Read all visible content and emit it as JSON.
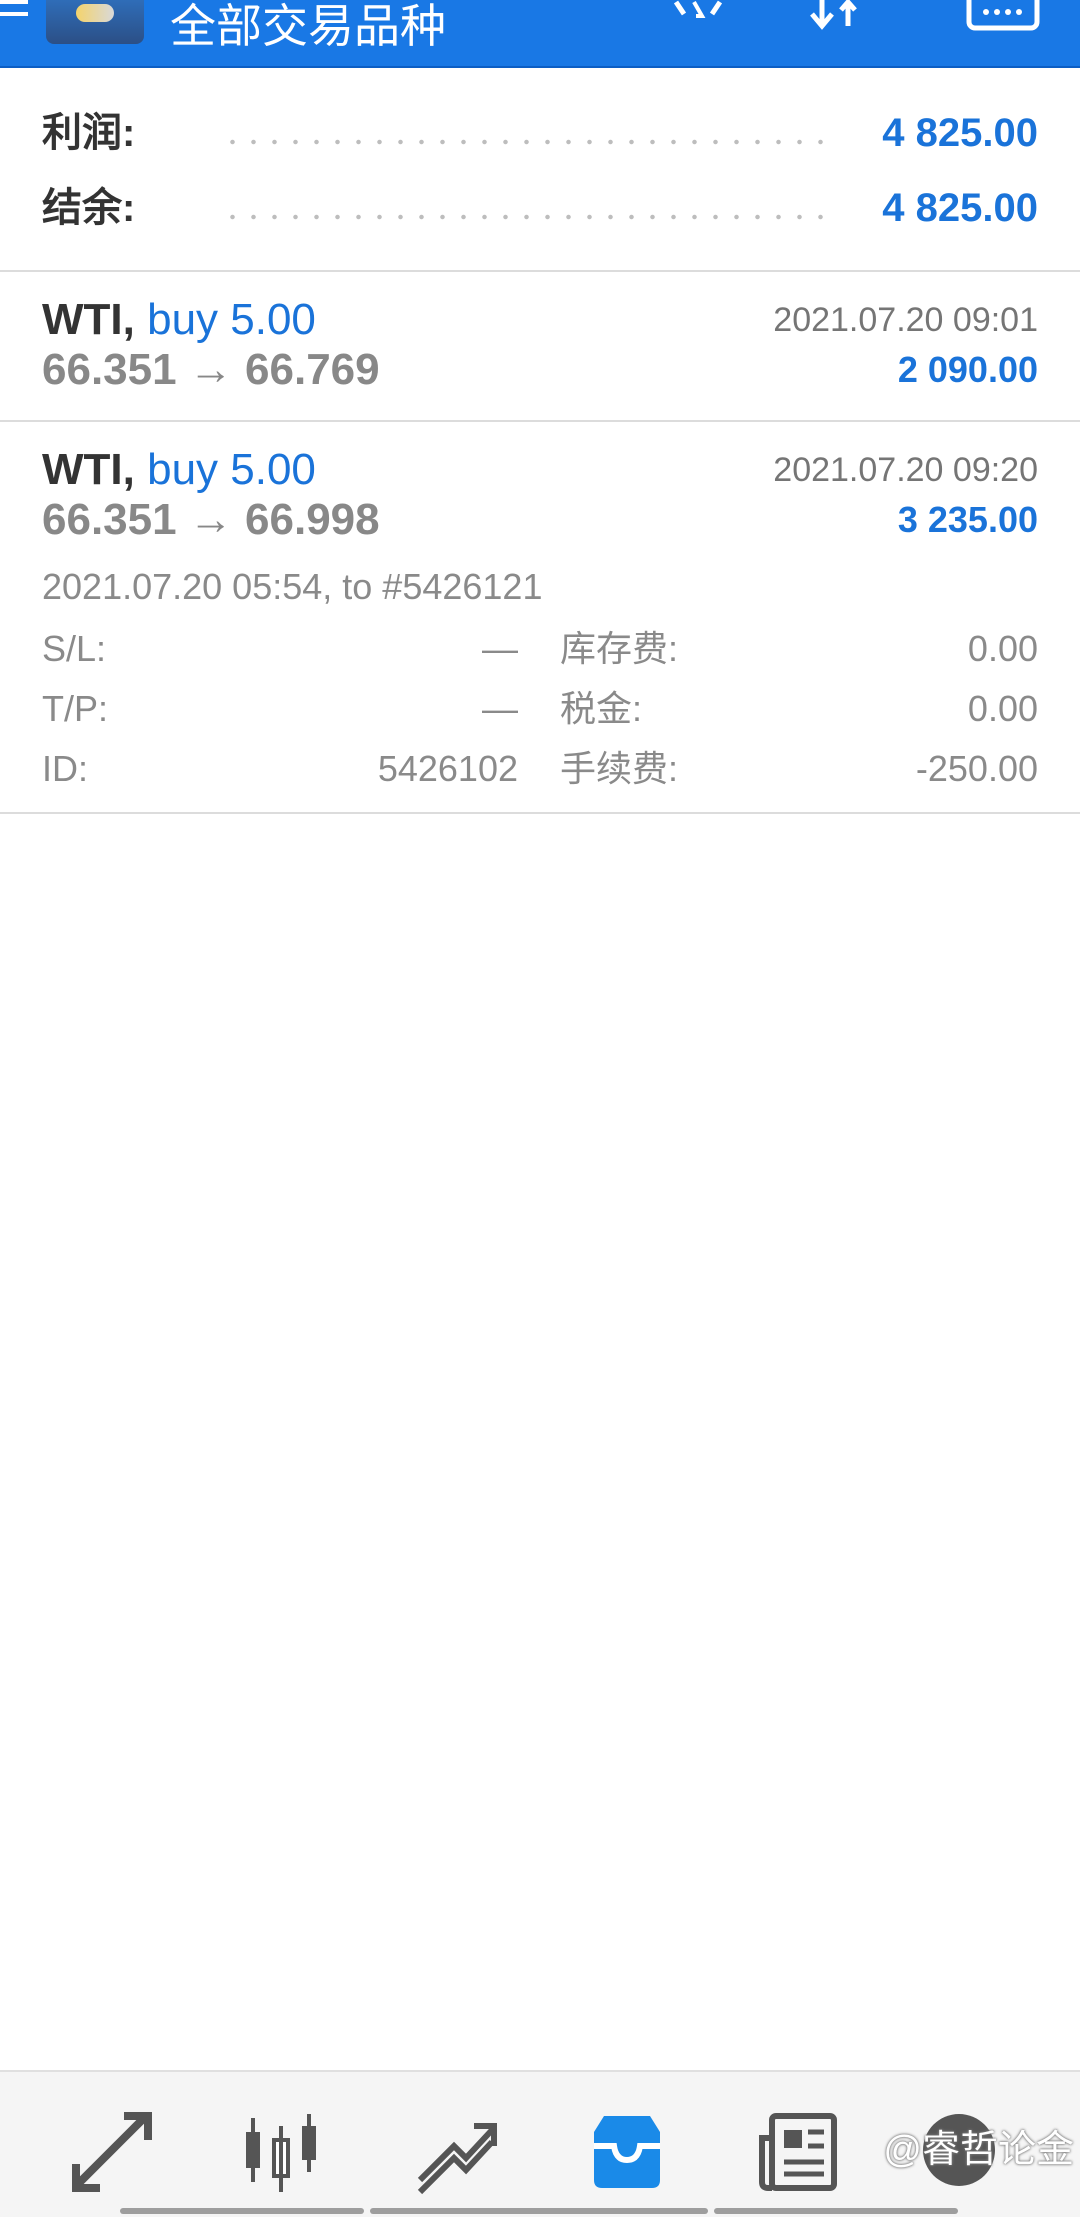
{
  "header": {
    "title": "全部交易品种"
  },
  "summary": {
    "profit_label": "利润:",
    "profit_value": "4 825.00",
    "balance_label": "结余:",
    "balance_value": "4 825.00"
  },
  "trades": [
    {
      "symbol": "WTI,",
      "side": "buy 5.00",
      "time": "2021.07.20 09:01",
      "prices": "66.351 → 66.769",
      "profit": "2 090.00"
    },
    {
      "symbol": "WTI,",
      "side": "buy 5.00",
      "time": "2021.07.20 09:20",
      "prices": "66.351 → 66.998",
      "profit": "3 235.00",
      "open_info": "2021.07.20 05:54, to #5426121",
      "details": {
        "sl_label": "S/L:",
        "sl_value": "—",
        "tp_label": "T/P:",
        "tp_value": "—",
        "id_label": "ID:",
        "id_value": "5426102",
        "swap_label": "库存费:",
        "swap_value": "0.00",
        "tax_label": "税金:",
        "tax_value": "0.00",
        "commission_label": "手续费:",
        "commission_value": "-250.00"
      }
    }
  ],
  "bottom_nav": {
    "icons": [
      "quotes-icon",
      "chart-icon",
      "trade-icon",
      "history-icon",
      "news-icon",
      "chat-icon"
    ],
    "active": "history-icon",
    "active_color": "#1a8ae8"
  },
  "watermark": "@睿哲论金"
}
